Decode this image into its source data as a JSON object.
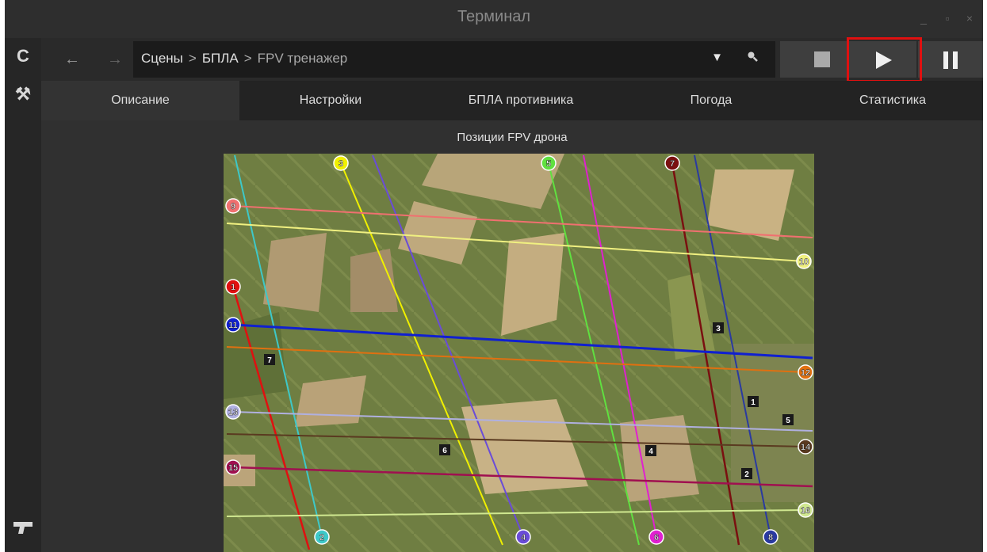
{
  "window": {
    "title": "Терминал",
    "minimize": "_",
    "maximize": "▫",
    "close": "×"
  },
  "leftbar": {
    "refresh_icon": "C",
    "tools_icon": "⚒",
    "gun_icon": "╗"
  },
  "nav": {
    "back": "←",
    "forward": "→",
    "breadcrumbs": [
      "Сцены",
      "БПЛА",
      "FPV тренажер"
    ],
    "separator": ">",
    "dropdown_icon": "▼",
    "search_icon": "🔍"
  },
  "tabs": [
    "Описание",
    "Настройки",
    "БПЛА противника",
    "Погода",
    "Статистика"
  ],
  "active_tab": "Описание",
  "content": {
    "title": "Позиции FPV дрона"
  },
  "colors": {
    "highlight": "#e01010",
    "background": "#303030"
  },
  "trajectories": [
    {
      "label": "1",
      "color": "#e01010"
    },
    {
      "label": "2",
      "color": "#3ec8c8"
    },
    {
      "label": "3",
      "color": "#f0f000"
    },
    {
      "label": "4",
      "color": "#6a4cd8"
    },
    {
      "label": "5",
      "color": "#60e040"
    },
    {
      "label": "6",
      "color": "#e020d0"
    },
    {
      "label": "7",
      "color": "#7a1010"
    },
    {
      "label": "8",
      "color": "#2a3aa0"
    },
    {
      "label": "9",
      "color": "#f07070"
    },
    {
      "label": "10",
      "color": "#f0f080"
    },
    {
      "label": "11",
      "color": "#1020d0"
    },
    {
      "label": "12",
      "color": "#e07010"
    },
    {
      "label": "13",
      "color": "#b0b0e0"
    },
    {
      "label": "14",
      "color": "#5a3a20"
    },
    {
      "label": "15",
      "color": "#a01050"
    },
    {
      "label": "16",
      "color": "#d0e890"
    }
  ],
  "markers": [
    "1",
    "2",
    "3",
    "4",
    "5",
    "6",
    "7"
  ]
}
